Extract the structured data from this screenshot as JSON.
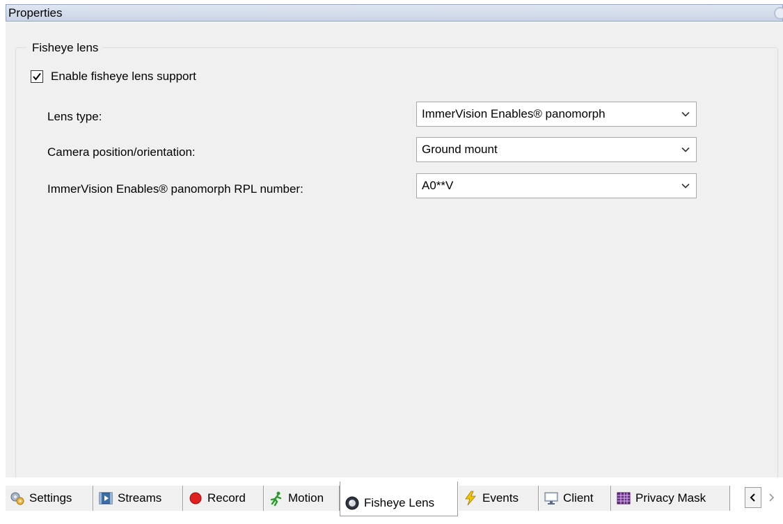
{
  "window": {
    "title": "Properties"
  },
  "group": {
    "label": "Fisheye lens",
    "enable_checkbox": {
      "label": "Enable fisheye lens support",
      "checked": true
    }
  },
  "fields": [
    {
      "label": "Lens type:",
      "value": "ImmerVision Enables® panomorph"
    },
    {
      "label": "Camera position/orientation:",
      "value": "Ground mount"
    },
    {
      "label": "ImmerVision Enables® panomorph RPL number:",
      "value": "A0**V"
    }
  ],
  "tabs": [
    {
      "label": "Settings",
      "icon": "settings-icon"
    },
    {
      "label": "Streams",
      "icon": "streams-icon"
    },
    {
      "label": "Record",
      "icon": "record-icon"
    },
    {
      "label": "Motion",
      "icon": "motion-icon"
    },
    {
      "label": "Fisheye Lens",
      "icon": "fisheye-icon",
      "active": true
    },
    {
      "label": "Events",
      "icon": "events-icon"
    },
    {
      "label": "Client",
      "icon": "client-icon"
    },
    {
      "label": "Privacy Mask",
      "icon": "privacy-mask-icon"
    }
  ],
  "colors": {
    "record": "#e02020",
    "motion": "#2a9a2a",
    "events": "#e8b400"
  }
}
